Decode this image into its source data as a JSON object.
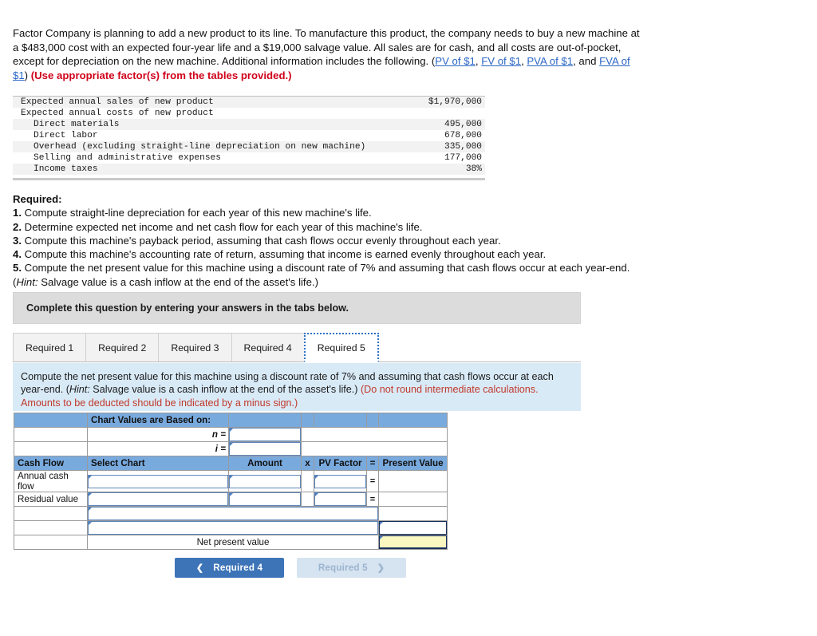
{
  "problem": {
    "intro_part1": "Factor Company is planning to add a new product to its line. To manufacture this product, the company needs to buy a new machine at a $483,000 cost with an expected four-year life and a $19,000 salvage value. All sales are for cash, and all costs are out-of-pocket, except for depreciation on the new machine. Additional information includes the following. (",
    "link_pv": "PV of $1",
    "sep1": ", ",
    "link_fv": "FV of $1",
    "sep2": ", ",
    "link_pva": "PVA of $1",
    "sep3": ", and ",
    "link_fva": "FVA of $1",
    "close_paren": ")",
    "instruction_red": "(Use appropriate factor(s) from the tables provided.)"
  },
  "facts_table": {
    "rows": [
      {
        "label": "Expected annual sales of new product",
        "value": "$1,970,000",
        "indent": false,
        "shaded": true
      },
      {
        "label": "Expected annual costs of new product",
        "value": "",
        "indent": false,
        "shaded": false
      },
      {
        "label": "Direct materials",
        "value": "495,000",
        "indent": true,
        "shaded": true
      },
      {
        "label": "Direct labor",
        "value": "678,000",
        "indent": true,
        "shaded": false
      },
      {
        "label": "Overhead (excluding straight-line depreciation on new machine)",
        "value": "335,000",
        "indent": true,
        "shaded": true
      },
      {
        "label": "Selling and administrative expenses",
        "value": "177,000",
        "indent": true,
        "shaded": false
      },
      {
        "label": "Income taxes",
        "value": "38%",
        "indent": true,
        "shaded": true
      }
    ]
  },
  "required": {
    "heading": "Required:",
    "items": [
      {
        "num": "1.",
        "text": "Compute straight-line depreciation for each year of this new machine's life."
      },
      {
        "num": "2.",
        "text": "Determine expected net income and net cash flow for each year of this machine's life."
      },
      {
        "num": "3.",
        "text": "Compute this machine's payback period, assuming that cash flows occur evenly throughout each year."
      },
      {
        "num": "4.",
        "text": "Compute this machine's accounting rate of return, assuming that income is earned evenly throughout each year."
      },
      {
        "num": "5.",
        "text": "Compute the net present value for this machine using a discount rate of 7% and assuming that cash flows occur at each year-end."
      }
    ],
    "hint_label": "Hint:",
    "hint_text": " Salvage value is a cash inflow at the end of the asset's life.)",
    "hint_open": "("
  },
  "banner": {
    "text": "Complete this question by entering your answers in the tabs below."
  },
  "tabs": {
    "items": [
      {
        "label": "Required 1",
        "active": false
      },
      {
        "label": "Required 2",
        "active": false
      },
      {
        "label": "Required 3",
        "active": false
      },
      {
        "label": "Required 4",
        "active": false
      },
      {
        "label": "Required 5",
        "active": true
      }
    ]
  },
  "panel": {
    "text_a": "Compute the net present value for this machine using a discount rate of 7% and assuming that cash flows occur at each year-end. (",
    "hint_label": "Hint:",
    "text_b": " Salvage value is a cash inflow at the end of the asset's life.) ",
    "red_note": "(Do not round intermediate calculations. Amounts to be deducted should be indicated by a minus sign.)"
  },
  "answer_grid": {
    "chart_header": "Chart Values are Based on:",
    "n_label": "n =",
    "i_label": "i =",
    "n_value": "",
    "i_value": "",
    "columns": {
      "cash_flow": "Cash Flow",
      "select_chart": "Select Chart",
      "amount": "Amount",
      "times": "x",
      "pv_factor": "PV Factor",
      "equals": "=",
      "present_value": "Present Value"
    },
    "rows": [
      {
        "cash_flow": "Annual cash flow",
        "select_chart": "",
        "amount": "",
        "pv_factor": "",
        "present_value": "",
        "eq": "="
      },
      {
        "cash_flow": "Residual value",
        "select_chart": "",
        "amount": "",
        "pv_factor": "",
        "present_value": "",
        "eq": "="
      }
    ],
    "extra_row_1": {
      "select_chart": "",
      "present_value": ""
    },
    "extra_row_2": {
      "select_chart": "",
      "present_value": ""
    },
    "npv_label": "Net present value",
    "npv_value": ""
  },
  "nav": {
    "prev_label": "Required 4",
    "prev_chevron": "❮",
    "next_label": "Required 5",
    "next_chevron": "❯"
  },
  "colors": {
    "header_blue": "#79aade",
    "panel_blue": "#d9eaf7",
    "accent_blue": "#3d74b8",
    "disabled_blue": "#d6e3f0",
    "link_blue": "#2b66c4",
    "red": "#c0392b",
    "yellow_cell": "#faf7c0",
    "banner_gray": "#dcdcdc"
  }
}
